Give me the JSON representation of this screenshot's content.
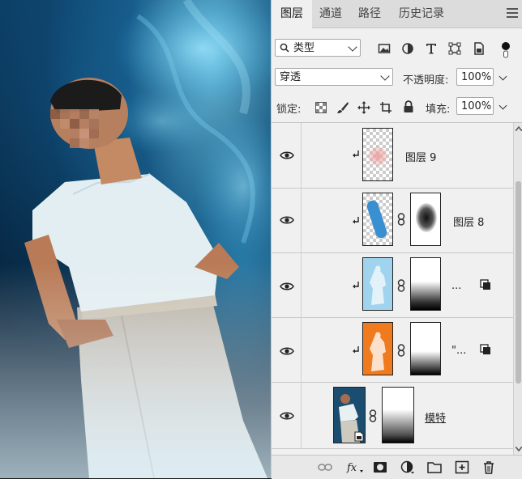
{
  "canvas": {
    "subject": "person-photo"
  },
  "panel": {
    "tabs": [
      {
        "label": "图层",
        "active": true
      },
      {
        "label": "通道",
        "active": false
      },
      {
        "label": "路径",
        "active": false
      },
      {
        "label": "历史记录",
        "active": false
      }
    ],
    "filter": {
      "kind_label": "类型"
    },
    "blend": {
      "mode": "穿透",
      "opacity_label": "不透明度:",
      "opacity": "100%"
    },
    "lock": {
      "label": "锁定:",
      "fill_label": "填充:",
      "fill": "100%"
    },
    "layers": [
      {
        "name": "图层 9",
        "clipped": true,
        "has_mask": false
      },
      {
        "name": "图层 8",
        "clipped": true,
        "has_mask": true
      },
      {
        "name": "...",
        "clipped": true,
        "has_mask": true,
        "smart": true
      },
      {
        "name": "\"...",
        "clipped": true,
        "has_mask": true,
        "smart": true
      },
      {
        "name": "模特",
        "clipped": false,
        "has_mask": true
      }
    ]
  },
  "colors": {
    "panel_bg": "#f0f0f0",
    "tab_bg": "#dcdcdc",
    "orange_layer": "#f07a1e",
    "blue_layer": "#9fd3ee"
  }
}
